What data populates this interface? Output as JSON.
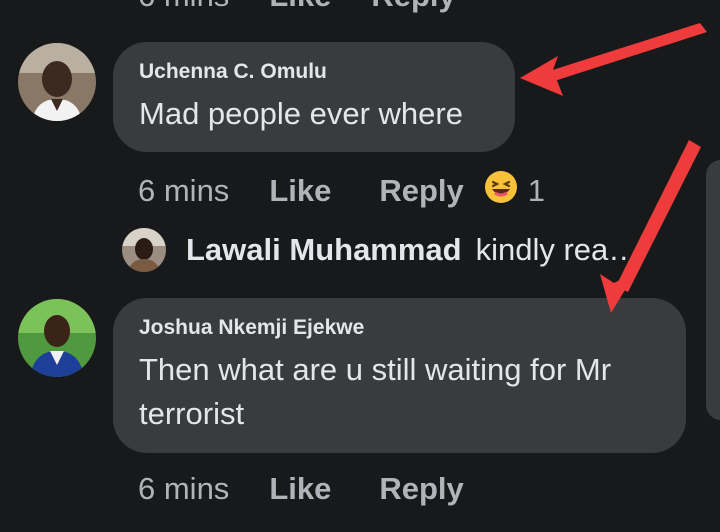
{
  "top": {
    "time": "6 mins",
    "like": "Like",
    "reply": "Reply"
  },
  "comments": [
    {
      "author": "Uchenna C. Omulu",
      "text": "Mad people ever where",
      "time": "6 mins",
      "like": "Like",
      "reply": "Reply",
      "reaction_icon": "laughing-face-icon",
      "reaction_count": "1"
    },
    {
      "author": "Joshua Nkemji Ejekwe",
      "text": "Then what are u still waiting for Mr terrorist",
      "time": "6 mins",
      "like": "Like",
      "reply": "Reply"
    }
  ],
  "reply_preview": {
    "name": "Lawali Muhammad",
    "snippet": "kindly rea…"
  },
  "annotation_color": "#ef3b3b"
}
